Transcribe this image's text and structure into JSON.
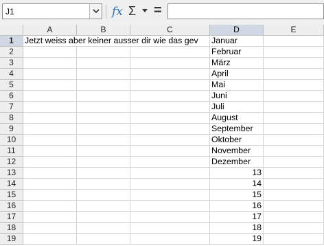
{
  "formula_bar": {
    "name_box_value": "J1",
    "input_value": ""
  },
  "columns": [
    "A",
    "B",
    "C",
    "D",
    "E"
  ],
  "active_column": "D",
  "rows": [
    "1",
    "2",
    "3",
    "4",
    "5",
    "6",
    "7",
    "8",
    "9",
    "10",
    "11",
    "12",
    "13",
    "14",
    "15",
    "16",
    "17",
    "18",
    "19"
  ],
  "active_row": "1",
  "cells": {
    "A1": "Jetzt weiss aber keiner ausser dir wie das gev",
    "D1": "Januar",
    "D2": "Februar",
    "D3": "März",
    "D4": "April",
    "D5": "Mai",
    "D6": "Juni",
    "D7": "Juli",
    "D8": "August",
    "D9": "September",
    "D10": "Oktober",
    "D11": "November",
    "D12": "Dezember",
    "D13": "13",
    "D14": "14",
    "D15": "15",
    "D16": "16",
    "D17": "17",
    "D18": "18",
    "D19": "19"
  }
}
